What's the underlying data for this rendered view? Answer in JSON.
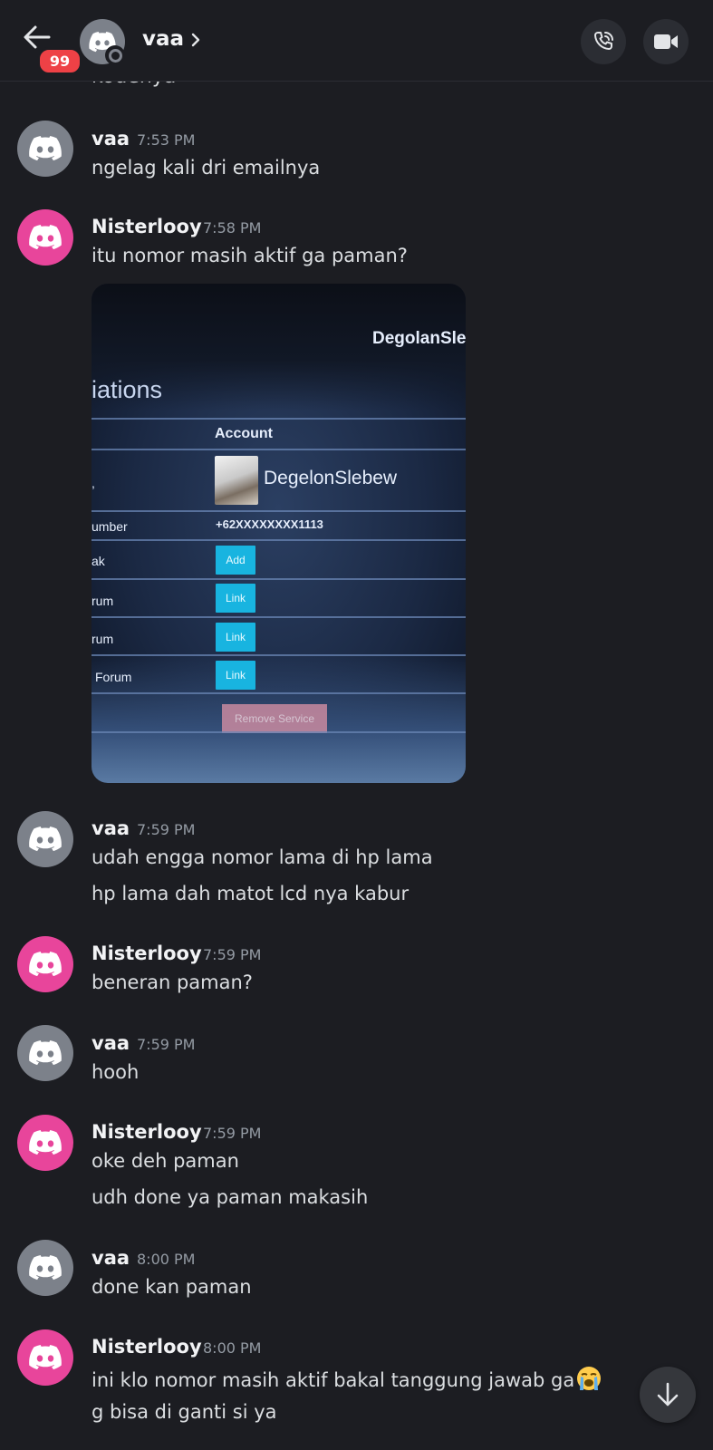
{
  "header": {
    "back_label": "Back",
    "badge_count": "99",
    "channel_name": "vaa",
    "avatar_icon": "discord-logo-icon",
    "call_icon": "phone-call-icon",
    "video_icon": "video-camera-icon"
  },
  "partial_message": "kodenya",
  "messages": [
    {
      "author": "vaa",
      "time": "7:53 PM",
      "lines": [
        "ngelag kali dri emailnya"
      ]
    },
    {
      "author": "Nisterlooy",
      "time": "7:58 PM",
      "lines": [
        "itu nomor masih aktif ga paman?"
      ]
    },
    {
      "author": "vaa",
      "time": "7:59 PM",
      "lines": [
        "udah engga nomor lama di hp lama",
        "hp lama dah matot lcd nya kabur"
      ]
    },
    {
      "author": "Nisterlooy",
      "time": "7:59 PM",
      "lines": [
        "beneran paman?"
      ]
    },
    {
      "author": "vaa",
      "time": "7:59 PM",
      "lines": [
        "hooh"
      ]
    },
    {
      "author": "Nisterlooy",
      "time": "7:59 PM",
      "lines": [
        "oke deh paman",
        "udh done ya paman makasih"
      ]
    },
    {
      "author": "vaa",
      "time": "8:00 PM",
      "lines": [
        "done kan paman"
      ]
    },
    {
      "author": "Nisterlooy",
      "time": "8:00 PM",
      "lines": [
        "ini klo nomor masih aktif bakal tanggung jawab ga",
        "g bisa di ganti si ya"
      ],
      "emoji": "loudly-crying-face-emoji"
    }
  ],
  "attachment": {
    "username_top": "DegolanSle",
    "section_title": "iations",
    "col_header": "Account",
    "account_name": "DegelonSlebew",
    "row_label_number": "umber",
    "phone": "+62XXXXXXXX1113",
    "row_label_1": "ak",
    "row_label_2": "rum",
    "row_label_3": "rum",
    "row_label_4": "Forum",
    "btn_add": "Add",
    "btn_link": "Link",
    "btn_remove": "Remove Service"
  },
  "colors": {
    "background": "#1c1d22",
    "avatar_gray": "#7c818a",
    "avatar_pink": "#e8459b",
    "badge_red": "#ee4146"
  },
  "scroll_button_icon": "arrow-down-icon"
}
